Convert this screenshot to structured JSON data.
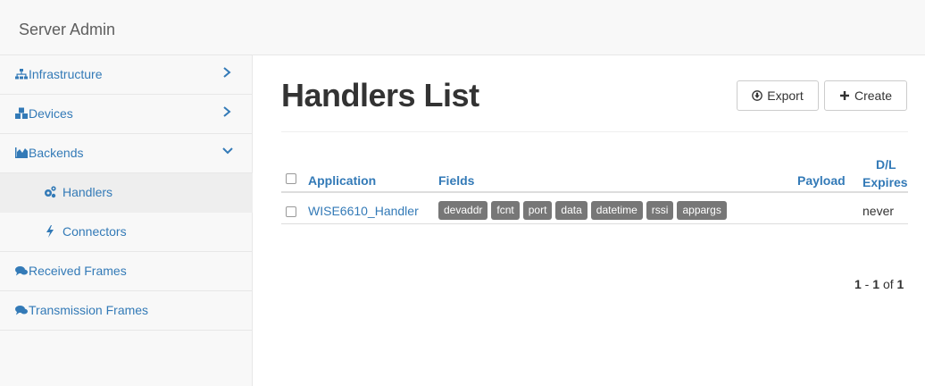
{
  "brand": "Server Admin",
  "sidebar": {
    "items": [
      {
        "label": "Infrastructure",
        "icon": "sitemap-icon",
        "chevron": "›"
      },
      {
        "label": "Devices",
        "icon": "cubes-icon",
        "chevron": "›"
      },
      {
        "label": "Backends",
        "icon": "area-chart-icon",
        "chevron": "⌄"
      },
      {
        "label": "Handlers",
        "icon": "cogs-icon"
      },
      {
        "label": "Connectors",
        "icon": "bolt-icon"
      },
      {
        "label": "Received Frames",
        "icon": "comments-icon"
      },
      {
        "label": "Transmission Frames",
        "icon": "comments-icon"
      }
    ]
  },
  "main": {
    "title": "Handlers List",
    "export_label": "Export",
    "create_label": "Create",
    "table": {
      "headers": {
        "application": "Application",
        "fields": "Fields",
        "payload": "Payload",
        "dl_expires_line1": "D/L",
        "dl_expires_line2": "Expires"
      },
      "rows": [
        {
          "application": "WISE6610_Handler",
          "fields": [
            "devaddr",
            "fcnt",
            "port",
            "data",
            "datetime",
            "rssi",
            "appargs"
          ],
          "payload": "",
          "dl_expires": "never"
        }
      ]
    },
    "pagination": {
      "start": "1",
      "end": "1",
      "of_label": "of",
      "total": "1"
    }
  },
  "colors": {
    "link": "#337ab7",
    "tag": "#777777",
    "sidebar_bg": "#f8f8f8",
    "active_bg": "#eeeeee"
  }
}
